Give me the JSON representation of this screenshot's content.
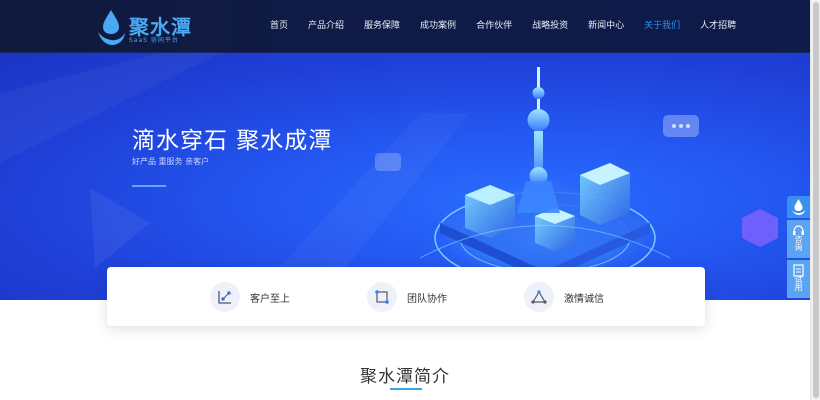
{
  "header": {
    "logo_text": "聚水潭",
    "logo_sub": "SaaS 协同平台",
    "logo_color": "#49a9f2",
    "nav": [
      {
        "label": "首页",
        "active": false
      },
      {
        "label": "产品介绍",
        "active": false
      },
      {
        "label": "服务保障",
        "active": false
      },
      {
        "label": "成功案例",
        "active": false
      },
      {
        "label": "合作伙伴",
        "active": false
      },
      {
        "label": "战略投资",
        "active": false
      },
      {
        "label": "新闻中心",
        "active": false
      },
      {
        "label": "关于我们",
        "active": true
      },
      {
        "label": "人才招聘",
        "active": false
      }
    ]
  },
  "hero": {
    "title": "滴水穿石 聚水成潭",
    "subtitle": "好产品 重服务 亲客户"
  },
  "features": [
    {
      "label": "客户至上",
      "icon": "chart-dot-icon"
    },
    {
      "label": "团队协作",
      "icon": "connect-square-icon"
    },
    {
      "label": "激情诚信",
      "icon": "triangle-network-icon"
    }
  ],
  "section": {
    "title": "聚水潭简介"
  },
  "side_widget": {
    "consult_label": "咨询",
    "trial_label": "试用"
  },
  "colors": {
    "accent": "#2f8df2",
    "hero_blue": "#2356f0",
    "header_bg": "#101a3d"
  }
}
